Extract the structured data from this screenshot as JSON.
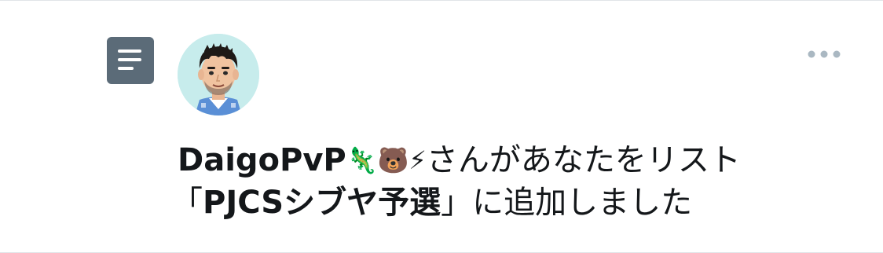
{
  "notification": {
    "type_icon": "list-icon",
    "avatar_icon": "user-avatar-icon",
    "more_icon": "more-options-icon",
    "user_name": "DaigoPvP",
    "user_name_emoji": "🦎🐻⚡",
    "message_part1": "さんがあなたをリスト",
    "quote_open": "「",
    "list_name": "PJCSシブヤ予選",
    "quote_close": "」",
    "message_part2": "に追加しました"
  },
  "colors": {
    "icon_bg": "#5b6b78",
    "text": "#14171a",
    "more_dots": "#aab8c2",
    "divider": "#e1e4e8",
    "avatar_bg": "#c7ecec"
  }
}
